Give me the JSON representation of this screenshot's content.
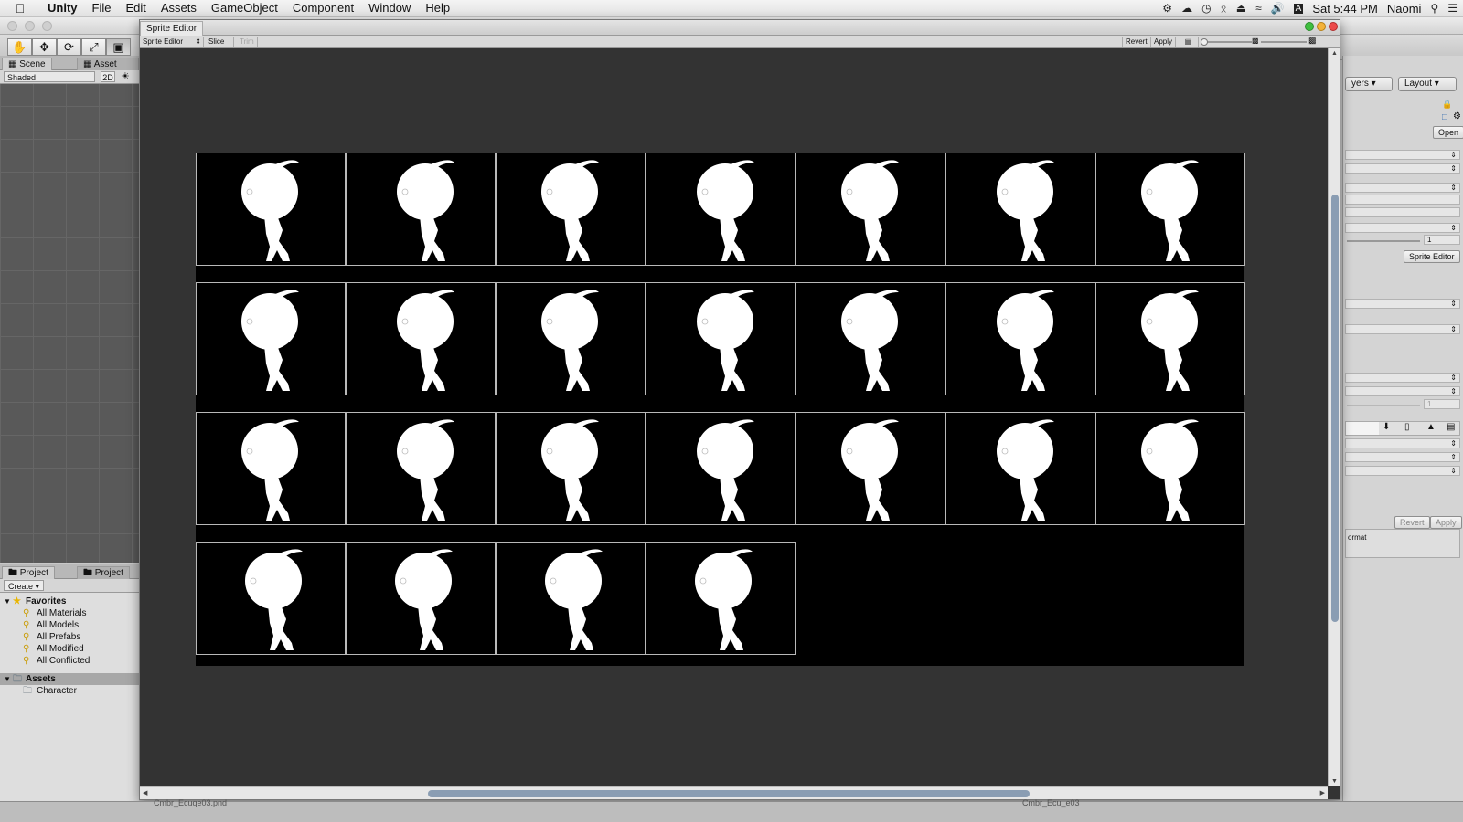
{
  "menubar": {
    "app": "Unity",
    "items": [
      "File",
      "Edit",
      "Assets",
      "GameObject",
      "Component",
      "Window",
      "Help"
    ],
    "status_icons": [
      "notification-icon",
      "cloud-icon",
      "time-machine-icon",
      "bluetooth-icon",
      "eject-icon",
      "wifi-icon",
      "volume-icon",
      "input-source-icon"
    ],
    "clock": "Sat 5:44 PM",
    "user": "Naomi"
  },
  "toolbar": {
    "tools": [
      "hand-tool-icon",
      "move-tool-icon",
      "rotate-tool-icon",
      "scale-tool-icon",
      "rect-tool-icon"
    ],
    "layers_label": "yers",
    "layout_label": "Layout"
  },
  "scene": {
    "tab_scene": "Scene",
    "tab_asset_store": "Asset Store",
    "shading": "Shaded",
    "mode_2d": "2D"
  },
  "project": {
    "tab_project": "Project",
    "tab_project2": "Project",
    "create_label": "Create",
    "favorites_label": "Favorites",
    "favorites": [
      "All Materials",
      "All Models",
      "All Prefabs",
      "All Modified",
      "All Conflicted"
    ],
    "assets_label": "Assets",
    "assets": [
      "Character"
    ]
  },
  "sprite_editor": {
    "window_title": "Sprite Editor",
    "mode_dropdown": "Sprite Editor",
    "slice_label": "Slice",
    "trim_label": "Trim",
    "revert_label": "Revert",
    "apply_label": "Apply",
    "rows": [
      7,
      7,
      7,
      4
    ]
  },
  "inspector": {
    "open_label": "Open",
    "field_value_1": "1",
    "field_value_2": "1",
    "sprite_editor_button": "Sprite Editor",
    "revert_label": "Revert",
    "apply_label": "Apply",
    "format_text": "ormat"
  },
  "footer": {
    "left_text": "Cmbr_Ecuqe03.pnd",
    "right_text": "Cmbr_Ecu_e03"
  }
}
